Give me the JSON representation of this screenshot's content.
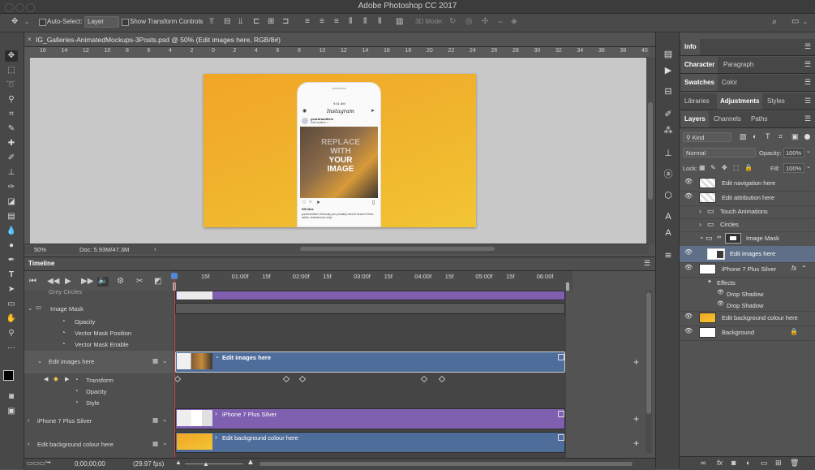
{
  "window": {
    "title": "Adobe Photoshop CC 2017"
  },
  "options_bar": {
    "auto_select_label": "Auto-Select:",
    "auto_select_value": "Layer",
    "show_transform_label": "Show Transform Controls",
    "mode_3d_label": "3D Mode:"
  },
  "document": {
    "tab_title": "IG_Galleries-AnimatedMockups-3Posts.psd @ 50% (Edit images here, RGB/8#)",
    "ruler_marks": [
      "16",
      "14",
      "12",
      "10",
      "8",
      "6",
      "4",
      "2",
      "0",
      "2",
      "4",
      "6",
      "8",
      "10",
      "12",
      "14",
      "16",
      "18",
      "20",
      "22",
      "24",
      "26",
      "28",
      "30",
      "32",
      "34",
      "36",
      "38",
      "40"
    ],
    "zoom": "50%",
    "doc_size": "Doc: 5.93M/47.3M"
  },
  "mockup": {
    "time": "9:41 AM",
    "app_name": "Instagram",
    "username": "yourbrandhere",
    "location": "Edit location >",
    "placeholder_lines": [
      "REPLACE",
      "WITH",
      "YOUR",
      "IMAGE"
    ],
    "likes": "926 likes",
    "caption": "yourbrandhere Seriously you probably haven't heard of them seitan, chicharrones vinyl..."
  },
  "timeline": {
    "panel_title": "Timeline",
    "ruler_labels": [
      "15f",
      "01:00f",
      "15f",
      "02:00f",
      "15f",
      "03:00f",
      "15f",
      "04:00f",
      "15f",
      "05:00f",
      "15f",
      "06:00f"
    ],
    "tracks": [
      {
        "name": "Grey Circles"
      },
      {
        "name": "Image Mask",
        "props": [
          "Opacity",
          "Vector Mask Position",
          "Vector Mask Enable"
        ]
      },
      {
        "name": "Edit images here",
        "props": [
          "Transform",
          "Opacity",
          "Style"
        ],
        "clip_label": "Edit images here"
      },
      {
        "name": "iPhone 7 Plus Silver",
        "clip_label": "iPhone 7 Plus Silver"
      },
      {
        "name": "Edit background colour here",
        "clip_label": "Edit background colour here"
      }
    ],
    "timecode": "0;00;00;00",
    "fps": "(29.97 fps)"
  },
  "panels": {
    "info_tab": "Info",
    "char_tabs": [
      "Character",
      "Paragraph"
    ],
    "swatch_tabs": [
      "Swatches",
      "Color"
    ],
    "adj_tabs": [
      "Libraries",
      "Adjustments",
      "Styles"
    ],
    "layer_tabs": [
      "Layers",
      "Channels",
      "Paths"
    ],
    "kind_filter": "Kind",
    "blend_mode": "Normal",
    "opacity_label": "Opacity:",
    "opacity_value": "100%",
    "lock_label": "Lock:",
    "fill_label": "Fill:",
    "fill_value": "100%"
  },
  "layers": [
    {
      "name": "Edit navigation here"
    },
    {
      "name": "Edit attribution here"
    },
    {
      "name": "Touch Animations"
    },
    {
      "name": "Circles"
    },
    {
      "name": "Image Mask"
    },
    {
      "name": "Edit images here"
    },
    {
      "name": "iPhone 7 Plus Silver"
    },
    {
      "name": "Effects"
    },
    {
      "name": "Drop Shadow"
    },
    {
      "name": "Drop Shadow"
    },
    {
      "name": "Edit background colour here"
    },
    {
      "name": "Background"
    }
  ],
  "colors": {
    "accent_blue": "#5f6f87",
    "clip_purple": "#7f5fb0",
    "clip_blue": "#4f6d9b",
    "playhead": "#d84545",
    "artboard_orange": "#f2a526"
  }
}
